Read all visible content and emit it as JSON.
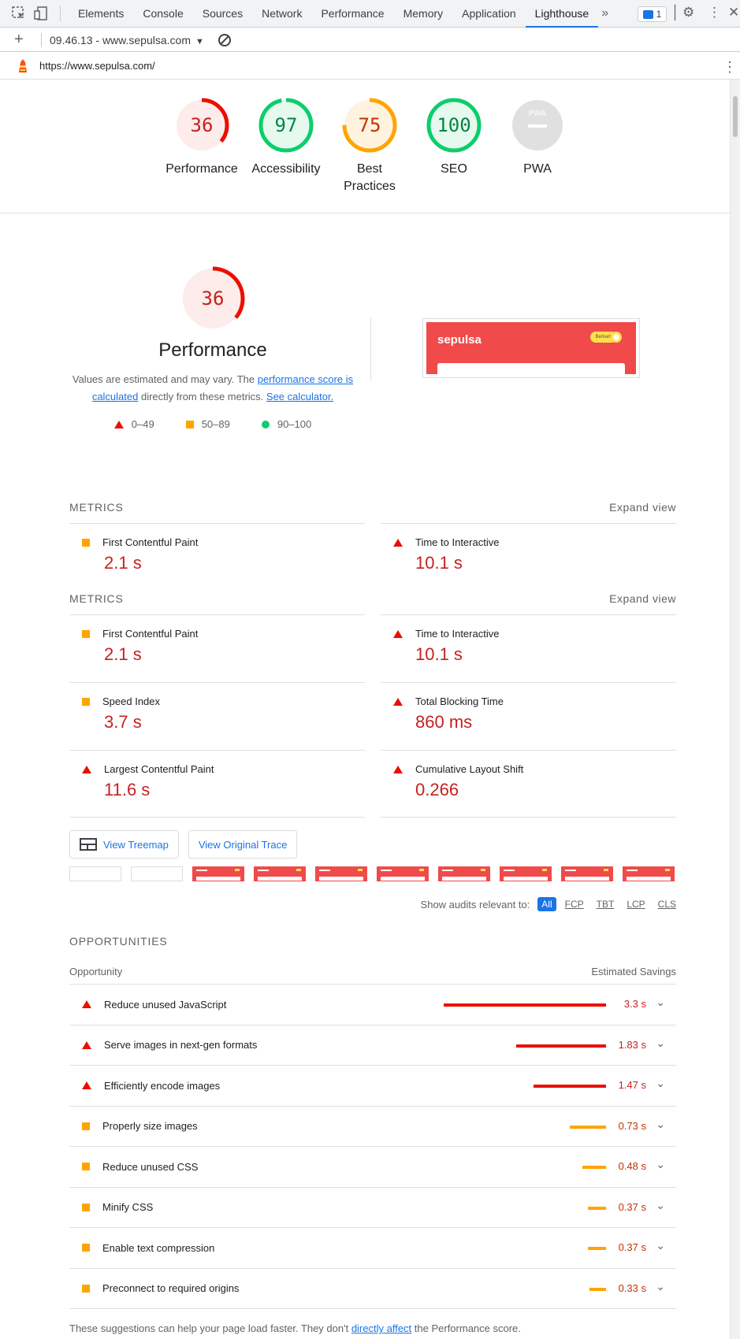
{
  "devtools": {
    "tabs": [
      "Elements",
      "Console",
      "Sources",
      "Network",
      "Performance",
      "Memory",
      "Application",
      "Lighthouse"
    ],
    "active_tab": "Lighthouse",
    "more": "»",
    "issues_count": "1"
  },
  "report_bar": {
    "plus": "+",
    "selected_report": "09.46.13 - www.sepulsa.com",
    "caret": "▼"
  },
  "url_bar": {
    "url": "https://www.sepulsa.com/"
  },
  "gauges": [
    {
      "label": "Performance",
      "score": "36",
      "status": "fail"
    },
    {
      "label": "Accessibility",
      "score": "97",
      "status": "pass"
    },
    {
      "label": "Best Practices",
      "score": "75",
      "status": "average"
    },
    {
      "label": "SEO",
      "score": "100",
      "status": "pass"
    },
    {
      "label": "PWA",
      "score": "",
      "status": "na",
      "badge": "PWA"
    }
  ],
  "performance": {
    "score": "36",
    "title": "Performance",
    "desc_1": "Values are estimated and may vary. The ",
    "desc_link_1": "performance score is calculated",
    "desc_2": " directly from these metrics. ",
    "desc_link_2": "See calculator.",
    "legend": [
      "0–49",
      "50–89",
      "90–100"
    ]
  },
  "screenshot": {
    "brand": "sepulsa",
    "pill": "Berkam"
  },
  "metrics_header": {
    "title": "METRICS",
    "expand": "Expand view"
  },
  "metrics_partial": [
    {
      "label": "First Contentful Paint",
      "value": "2.1 s",
      "status": "average"
    },
    {
      "label": "Time to Interactive",
      "value": "10.1 s",
      "status": "fail"
    }
  ],
  "metrics": [
    {
      "label": "First Contentful Paint",
      "value": "2.1 s",
      "status": "average"
    },
    {
      "label": "Time to Interactive",
      "value": "10.1 s",
      "status": "fail"
    },
    {
      "label": "Speed Index",
      "value": "3.7 s",
      "status": "average"
    },
    {
      "label": "Total Blocking Time",
      "value": "860 ms",
      "status": "fail"
    },
    {
      "label": "Largest Contentful Paint",
      "value": "11.6 s",
      "status": "fail"
    },
    {
      "label": "Cumulative Layout Shift",
      "value": "0.266",
      "status": "fail"
    }
  ],
  "buttons": {
    "treemap": "View Treemap",
    "trace": "View Original Trace"
  },
  "filmstrip_frames": [
    "blank",
    "blank",
    "red",
    "red",
    "red",
    "red",
    "red",
    "red",
    "red",
    "red"
  ],
  "filters": {
    "label": "Show audits relevant to:",
    "chips": [
      "All",
      "FCP",
      "TBT",
      "LCP",
      "CLS"
    ],
    "active": "All"
  },
  "opportunities": {
    "title": "OPPORTUNITIES",
    "col_left": "Opportunity",
    "col_right": "Estimated Savings",
    "rows": [
      {
        "title": "Reduce unused JavaScript",
        "savings": "3.3 s",
        "seconds": 3.3,
        "status": "fail"
      },
      {
        "title": "Serve images in next-gen formats",
        "savings": "1.83 s",
        "seconds": 1.83,
        "status": "fail"
      },
      {
        "title": "Efficiently encode images",
        "savings": "1.47 s",
        "seconds": 1.47,
        "status": "fail"
      },
      {
        "title": "Properly size images",
        "savings": "0.73 s",
        "seconds": 0.73,
        "status": "average"
      },
      {
        "title": "Reduce unused CSS",
        "savings": "0.48 s",
        "seconds": 0.48,
        "status": "average"
      },
      {
        "title": "Minify CSS",
        "savings": "0.37 s",
        "seconds": 0.37,
        "status": "average"
      },
      {
        "title": "Enable text compression",
        "savings": "0.37 s",
        "seconds": 0.37,
        "status": "average"
      },
      {
        "title": "Preconnect to required origins",
        "savings": "0.33 s",
        "seconds": 0.33,
        "status": "average"
      }
    ]
  },
  "footer": {
    "text_1": "These suggestions can help your page load faster. They don't ",
    "link": "directly affect",
    "text_2": " the Performance score."
  },
  "colors": {
    "fail": "#eb0f00",
    "average": "#ffa400",
    "pass": "#0cce6b",
    "fail_text": "#c5221f",
    "average_text": "#c33300",
    "pass_text": "#018642",
    "na": "#9e9e9e"
  }
}
